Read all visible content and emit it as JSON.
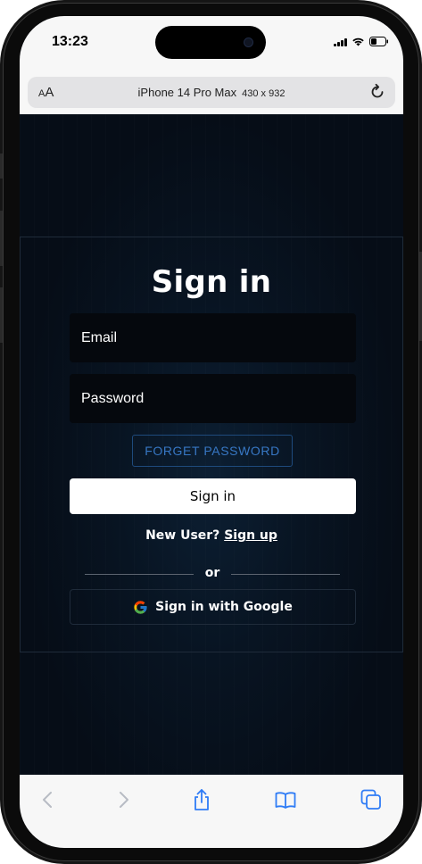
{
  "status_bar": {
    "time": "13:23"
  },
  "browser": {
    "text_size_label": "AA",
    "device_name": "iPhone 14 Pro Max",
    "device_dims": "430 x 932"
  },
  "signin": {
    "title": "Sign in",
    "email_placeholder": "Email",
    "password_placeholder": "Password",
    "forget_password_label": "FORGET PASSWORD",
    "signin_button_label": "Sign in",
    "new_user_text": "New User?",
    "signup_link_label": "Sign up",
    "divider_text": "or",
    "google_button_label": "Sign in with Google"
  },
  "icons": {
    "reload": "reload-icon",
    "back": "chevron-left-icon",
    "forward": "chevron-right-icon",
    "share": "share-icon",
    "bookmarks": "book-icon",
    "tabs": "tabs-icon"
  },
  "colors": {
    "page_background": "#060d17",
    "link_accent": "#3777c4",
    "ios_disabled": "#b8bcc4",
    "ios_active": "#2f7cf6"
  }
}
